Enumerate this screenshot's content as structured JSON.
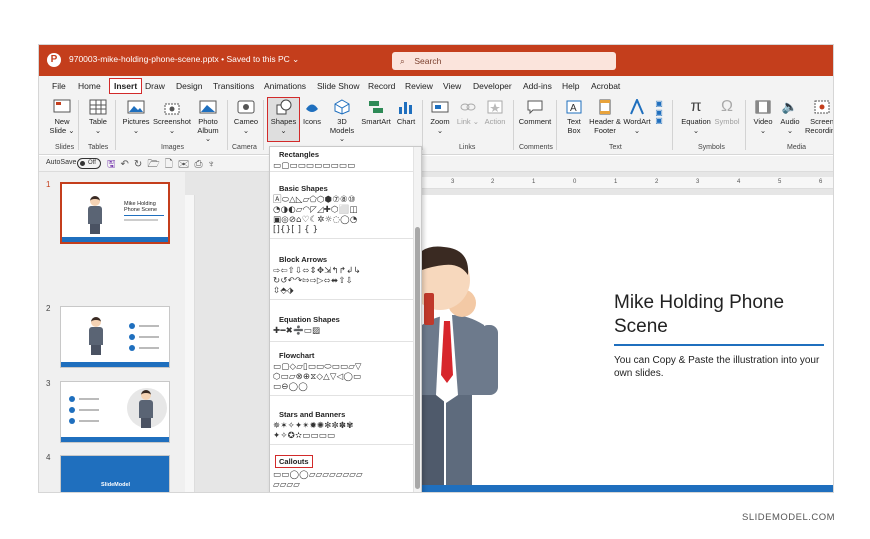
{
  "window": {
    "title": "970003-mike-holding-phone-scene.pptx • Saved to this PC ⌄",
    "search_placeholder": "Search"
  },
  "menu": [
    {
      "label": "File",
      "active": false
    },
    {
      "label": "Home",
      "active": false
    },
    {
      "label": "Insert",
      "active": true
    },
    {
      "label": "Draw",
      "active": false
    },
    {
      "label": "Design",
      "active": false
    },
    {
      "label": "Transitions",
      "active": false
    },
    {
      "label": "Animations",
      "active": false
    },
    {
      "label": "Slide Show",
      "active": false
    },
    {
      "label": "Record",
      "active": false
    },
    {
      "label": "Review",
      "active": false
    },
    {
      "label": "View",
      "active": false
    },
    {
      "label": "Developer",
      "active": false
    },
    {
      "label": "Add-ins",
      "active": false
    },
    {
      "label": "Help",
      "active": false
    },
    {
      "label": "Acrobat",
      "active": false
    }
  ],
  "ribbon": {
    "buttons": {
      "new_slide": "New Slide ⌄",
      "table": "Table ⌄",
      "pictures": "Pictures ⌄",
      "screenshot": "Screenshot ⌄",
      "photo_album": "Photo Album ⌄",
      "cameo": "Cameo ⌄",
      "shapes": "Shapes ⌄",
      "icons": "Icons",
      "models_3d": "3D Models ⌄",
      "smartart": "SmartArt",
      "chart": "Chart",
      "zoom": "Zoom ⌄",
      "link": "Link ⌄",
      "action": "Action",
      "comment": "Comment",
      "text_box": "Text Box",
      "header_footer": "Header & Footer",
      "wordart": "WordArt ⌄",
      "equation": "Equation ⌄",
      "symbol": "Symbol",
      "video": "Video ⌄",
      "audio": "Audio ⌄",
      "screen_recording": "Screen Recording"
    },
    "groups": {
      "slides": "Slides",
      "tables": "Tables",
      "images": "Images",
      "camera": "Camera",
      "links": "Links",
      "comments": "Comments",
      "text": "Text",
      "symbols": "Symbols",
      "media": "Media"
    }
  },
  "qat": {
    "autosave_label": "AutoSave",
    "autosave_state": "Off"
  },
  "thumbnails": [
    {
      "number": "1",
      "selected": true,
      "title": "Mike Holding Phone Scene"
    },
    {
      "number": "2",
      "selected": false
    },
    {
      "number": "3",
      "selected": false
    },
    {
      "number": "4",
      "selected": false,
      "logo": "SlideModel"
    }
  ],
  "shapes_panel": {
    "sections": [
      {
        "header": "Rectangles",
        "glyphs": [
          "▭▢▭▭▭▭▭▭▭▭"
        ]
      },
      {
        "header": "Basic Shapes",
        "glyphs": [
          "🄰⬭△◺▱⬠⬡⬢⑦⑧⑩",
          "◔◑◐▱◠◸◿✚⬡⬜◫",
          "▣◎⊘⌂♡☾✲☼◌◯◔",
          "[]{}[ ] { }"
        ]
      },
      {
        "header": "Block Arrows",
        "glyphs": [
          "⇨⇦⇧⇩⬄⇕✥⇲↰↱↲↳",
          "↻↺↶↷⇰⇨▷⬄⬌⇧⇩",
          "⇳⬘⬗"
        ]
      },
      {
        "header": "Equation Shapes",
        "glyphs": [
          "✚━✖➗▭▨"
        ]
      },
      {
        "header": "Flowchart",
        "glyphs": [
          "▭▢◇▱▯▭▭⬭▭▭▱▽",
          "⬡▭▱⊗⊕⧖◇△▽◁◯▭",
          "▭⊖◯◯"
        ]
      },
      {
        "header": "Stars and Banners",
        "glyphs": [
          "✵✶✧✦✴✹✺✻✼✽✾",
          "✦✧✪✫▭▭▭▭"
        ]
      },
      {
        "header": "Callouts",
        "glyphs": [
          "▭▭◯◯▱▱▱▱▱▱▱▱",
          "▱▱▱▱"
        ]
      }
    ]
  },
  "ruler": {
    "ticks": [
      "3",
      "2",
      "1",
      "0",
      "1",
      "2",
      "3",
      "4",
      "5",
      "6"
    ]
  },
  "slide": {
    "title": "Mike Holding Phone Scene",
    "body": "You can Copy & Paste the illustration into your own slides."
  },
  "watermark": "SLIDEMODEL.COM",
  "colors": {
    "titlebar": "#c43e1c",
    "accent_blue": "#1f6fbe",
    "highlight_red": "#d22a2a"
  }
}
